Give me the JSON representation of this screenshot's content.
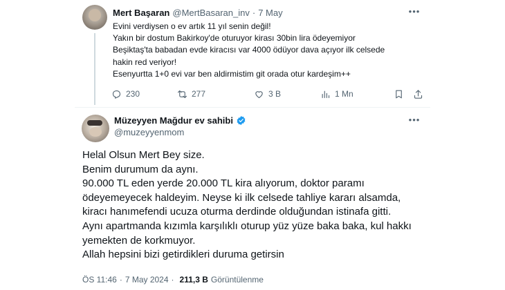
{
  "reply_tweet": {
    "author_name": "Mert Başaran",
    "author_handle": "@MertBasaran_inv",
    "separator": "·",
    "date": "7 May",
    "more_icon": "more-horizontal-icon",
    "lines": [
      "Evini verdiysen o ev artık 11 yıl senin değil!",
      "Yakın bir dostum Bakirkoy'de oturuyor kirası 30bin lira ödeyemiyor",
      "Beşiktaş'ta babadan evde kiracısı var 4000 ödüyor dava açıyor ilk celsede",
      "hakin red veriyor!",
      "Esenyurtta 1+0 evi var ben aldirmistim git orada otur kardeşim++"
    ],
    "actions": {
      "replies": "230",
      "retweets": "277",
      "likes": "3 B",
      "views": "1 Mn"
    }
  },
  "main_tweet": {
    "author_name": "Müzeyyen Mağdur ev sahibi",
    "author_handle": "@muzeyyenmom",
    "verified_icon": "verified-badge-icon",
    "lines": [
      "Helal Olsun Mert Bey size.",
      "Benim durumum da aynı.",
      "90.000 TL eden yerde 20.000 TL kira alıyorum, doktor paramı",
      "ödeyemeyecek haldeyim. Neyse ki ilk celsede tahliye kararı alsamda,",
      "kiracı hanımefendi ucuza oturma derdinde olduğundan istinafa gitti.",
      "Aynı apartmanda kızımla karşılıklı oturup yüz yüze baka baka, kul hakkı",
      "yemekten de korkmuyor.",
      "Allah hepsini bizi getirdikleri duruma getirsin"
    ],
    "meta": {
      "time": "ÖS 11:46",
      "date": "7 May 2024",
      "separator": "·",
      "views": "211,3 B",
      "views_label": "Görüntülenme"
    }
  },
  "colors": {
    "text_primary": "#0f1419",
    "text_secondary": "#536471",
    "verified_blue": "#1d9bf0",
    "divider": "#eff3f4"
  }
}
